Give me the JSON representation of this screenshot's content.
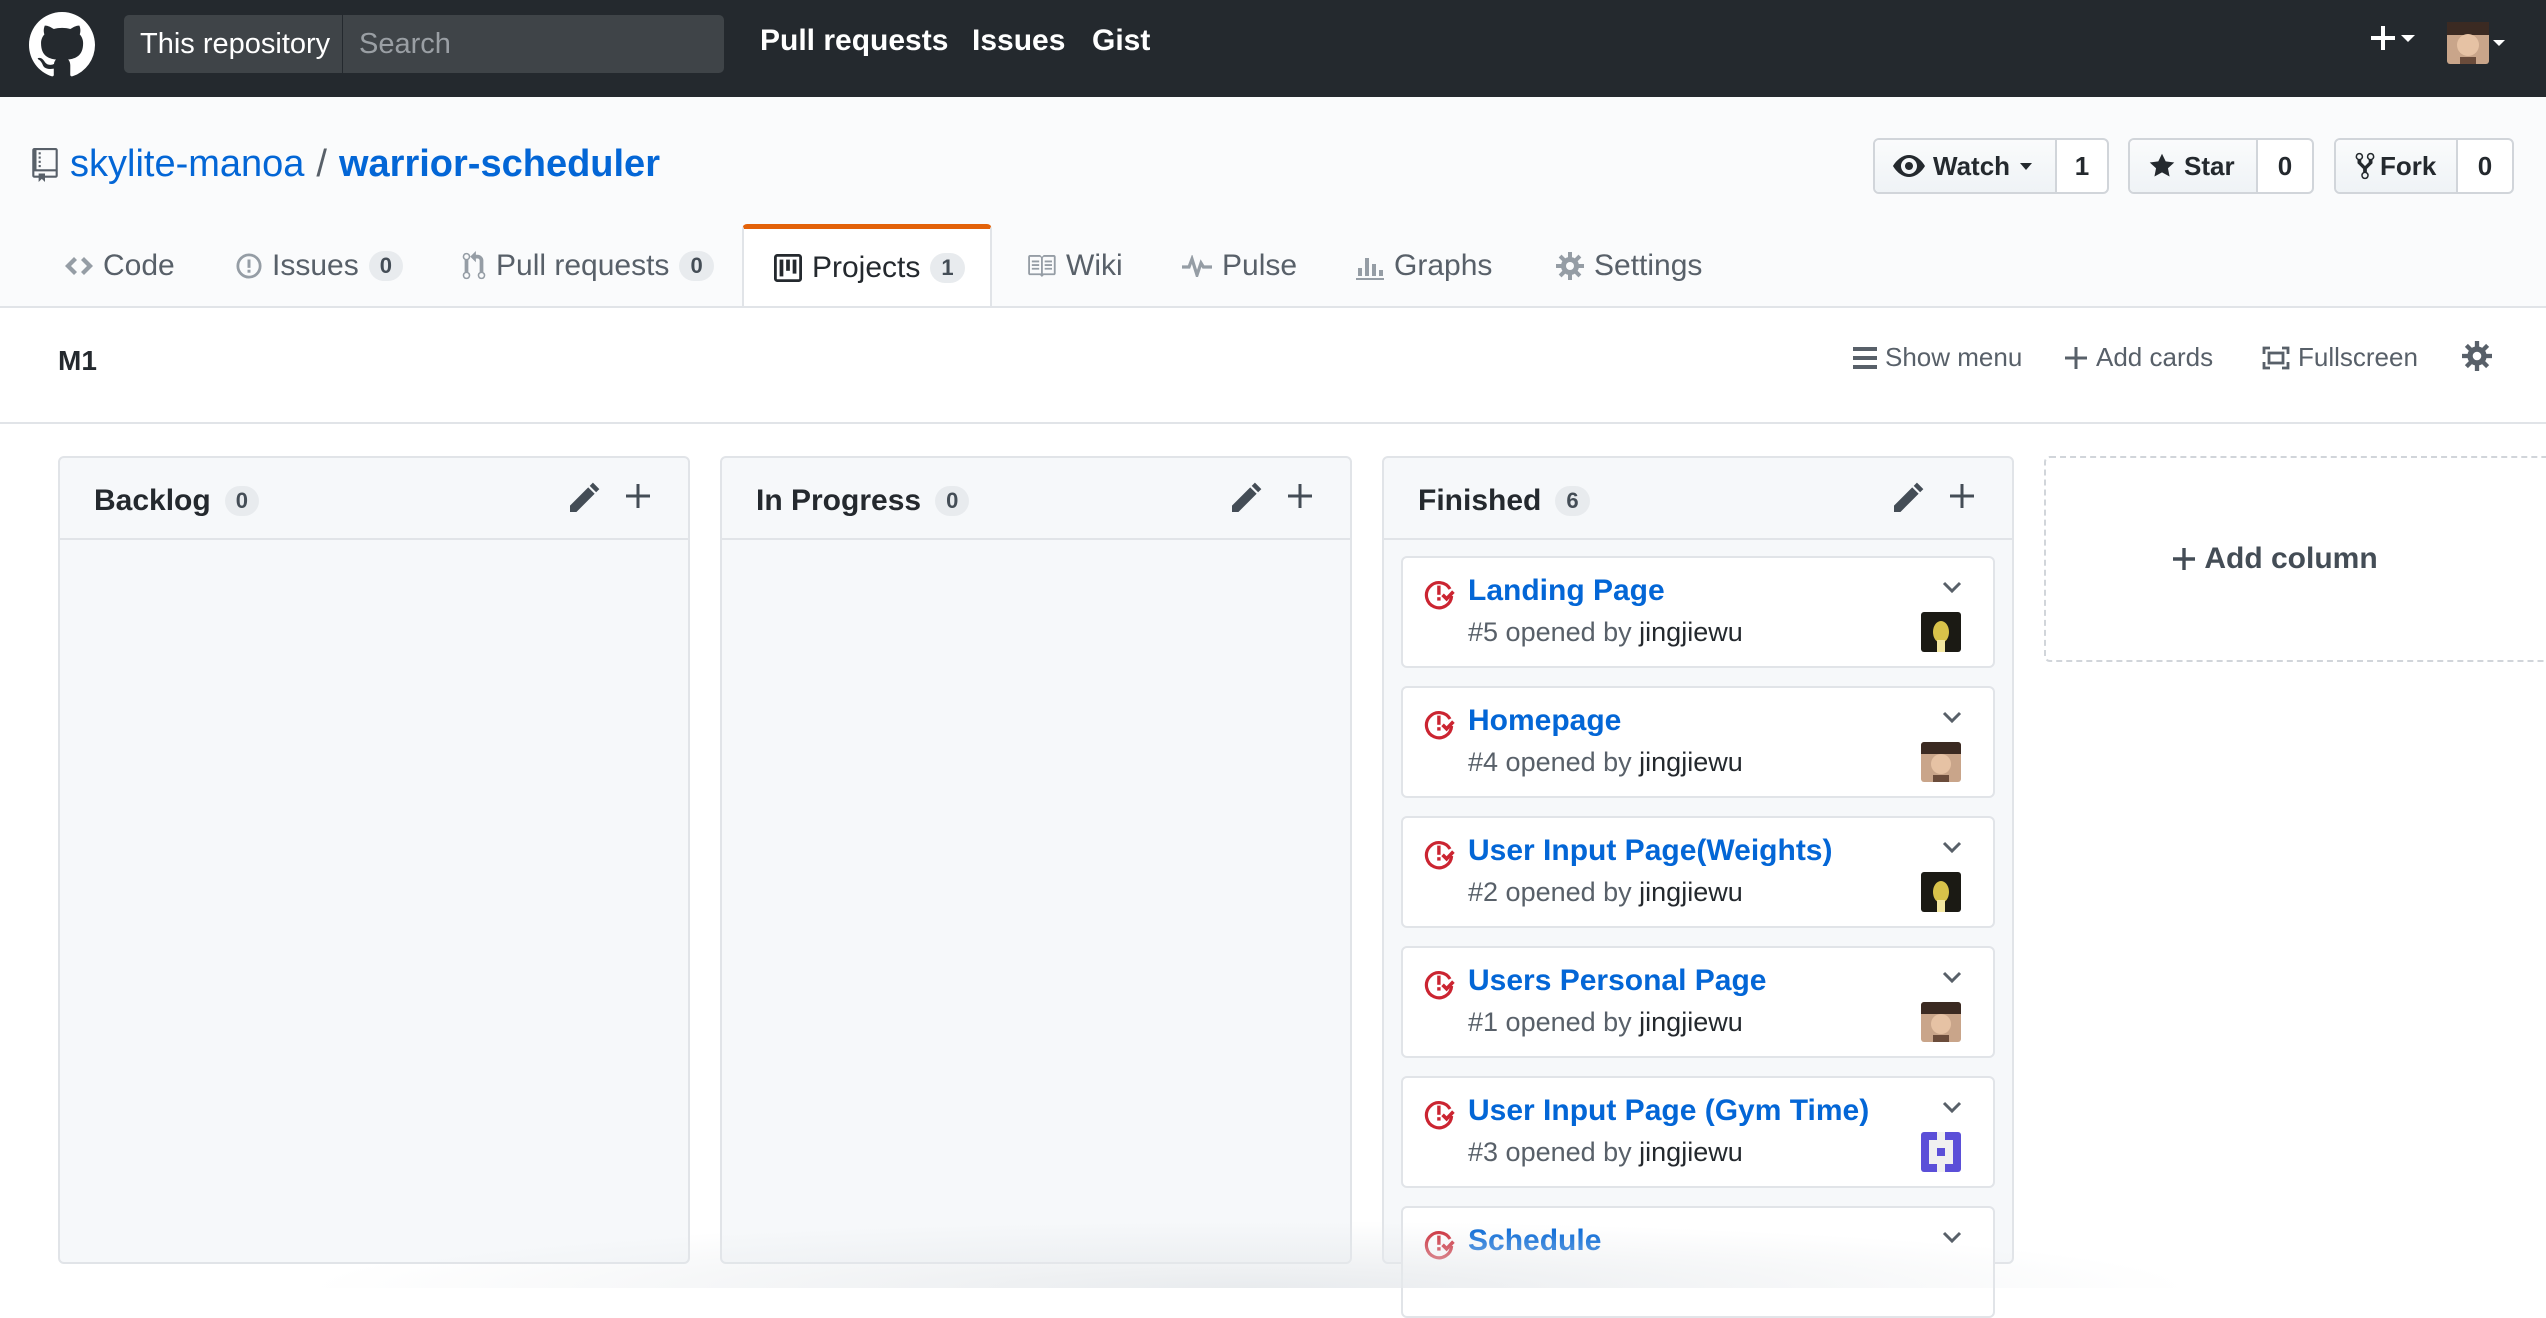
{
  "header": {
    "scope_label": "This repository",
    "search_placeholder": "Search",
    "nav": [
      "Pull requests",
      "Issues",
      "Gist"
    ]
  },
  "repo": {
    "owner": "skylite-manoa",
    "separator": "/",
    "name": "warrior-scheduler",
    "watch": {
      "label": "Watch",
      "count": "1"
    },
    "star": {
      "label": "Star",
      "count": "0"
    },
    "fork": {
      "label": "Fork",
      "count": "0"
    }
  },
  "tabs": [
    {
      "label": "Code",
      "icon": "code-icon"
    },
    {
      "label": "Issues",
      "count": "0",
      "icon": "issue-icon"
    },
    {
      "label": "Pull requests",
      "count": "0",
      "icon": "pull-request-icon"
    },
    {
      "label": "Projects",
      "count": "1",
      "icon": "project-icon",
      "selected": true
    },
    {
      "label": "Wiki",
      "icon": "book-icon"
    },
    {
      "label": "Pulse",
      "icon": "pulse-icon"
    },
    {
      "label": "Graphs",
      "icon": "graph-icon"
    },
    {
      "label": "Settings",
      "icon": "gear-icon"
    }
  ],
  "project": {
    "name": "M1",
    "actions": {
      "show_menu": "Show menu",
      "add_cards": "Add cards",
      "fullscreen": "Fullscreen"
    }
  },
  "columns": [
    {
      "title": "Backlog",
      "count": "0",
      "cards": []
    },
    {
      "title": "In Progress",
      "count": "0",
      "cards": []
    },
    {
      "title": "Finished",
      "count": "6",
      "cards": [
        {
          "title": "Landing Page",
          "number": "#5",
          "opened_by": "opened by",
          "author": "jingjiewu",
          "avatar": "dark"
        },
        {
          "title": "Homepage",
          "number": "#4",
          "opened_by": "opened by",
          "author": "jingjiewu",
          "avatar": "face"
        },
        {
          "title": "User Input Page(Weights)",
          "number": "#2",
          "opened_by": "opened by",
          "author": "jingjiewu",
          "avatar": "dark"
        },
        {
          "title": "Users Personal Page",
          "number": "#1",
          "opened_by": "opened by",
          "author": "jingjiewu",
          "avatar": "face"
        },
        {
          "title": "User Input Page (Gym Time)",
          "number": "#3",
          "opened_by": "opened by",
          "author": "jingjiewu",
          "avatar": "identicon"
        },
        {
          "title": "Schedule",
          "number": "",
          "opened_by": "",
          "author": "",
          "avatar": ""
        }
      ]
    }
  ],
  "add_column_label": "Add column",
  "colors": {
    "header_bg": "#24292e",
    "link": "#0366d6",
    "tab_accent": "#e36209",
    "closed_issue": "#cb2431"
  }
}
